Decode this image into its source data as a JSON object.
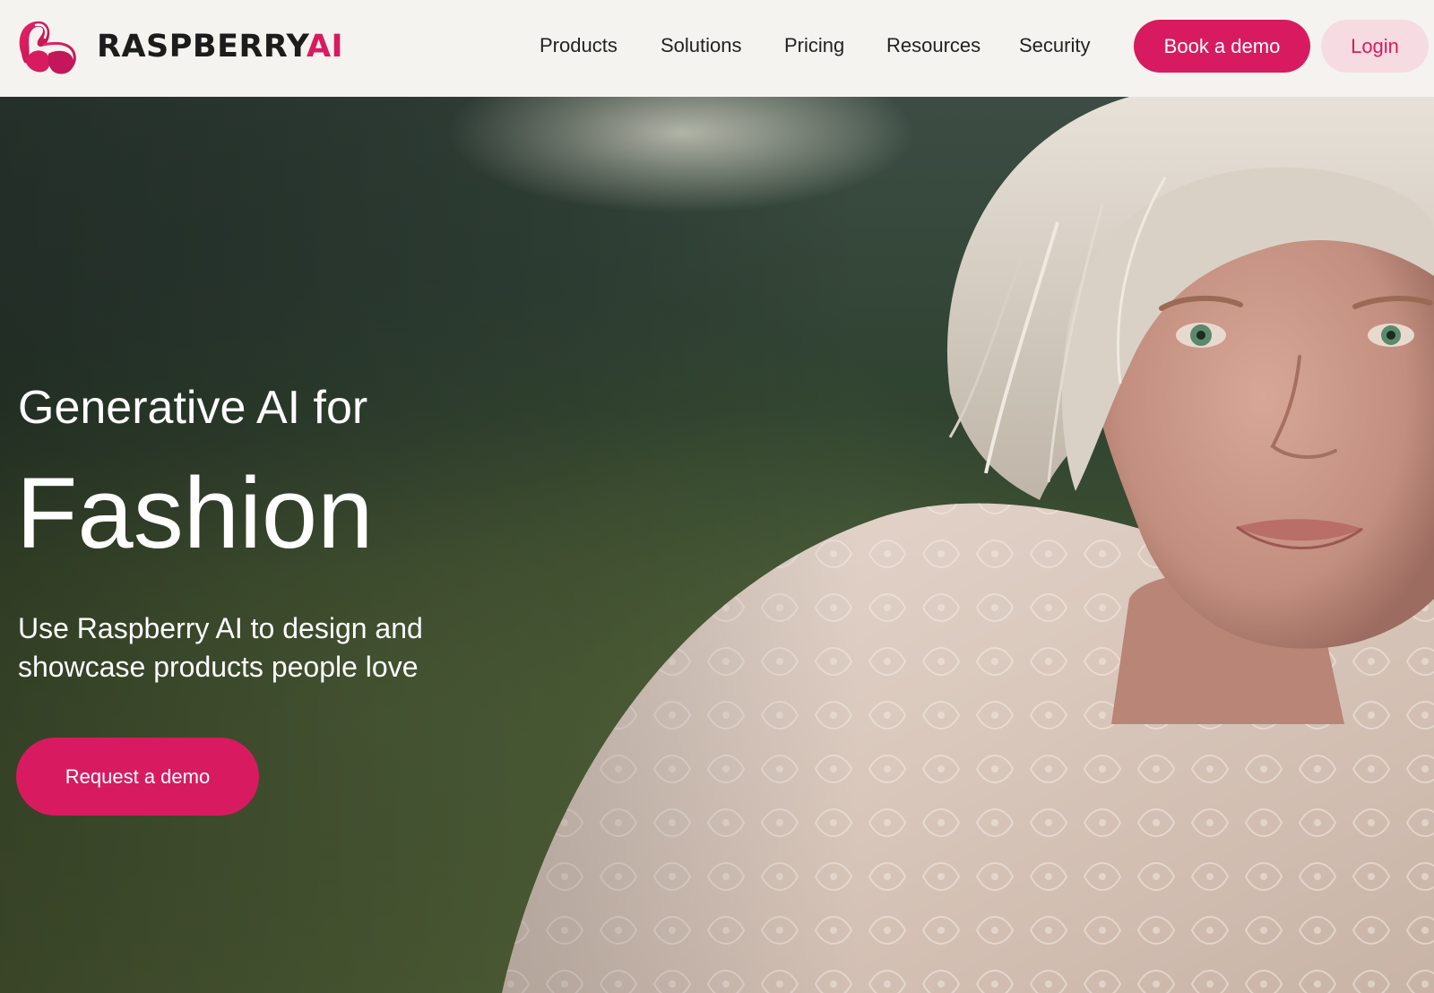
{
  "brand": {
    "name_main": "RASPBERRY",
    "name_accent": "AI",
    "logo_icon": "raspberry-r-logo",
    "accent_color": "#d81b60",
    "light_accent_color": "#f6dbe2"
  },
  "nav": {
    "items": [
      {
        "label": "Products"
      },
      {
        "label": "Solutions"
      },
      {
        "label": "Pricing"
      },
      {
        "label": "Resources"
      },
      {
        "label": "Security"
      }
    ],
    "book_demo_label": "Book a demo",
    "login_label": "Login"
  },
  "hero": {
    "pre_title": "Generative AI for",
    "title": "Fashion",
    "subtitle": "Use Raspberry AI to design and showcase products people love",
    "cta_label": "Request a demo",
    "image": "model-with-platinum-hair-in-white-lace-blouse-outdoors"
  }
}
